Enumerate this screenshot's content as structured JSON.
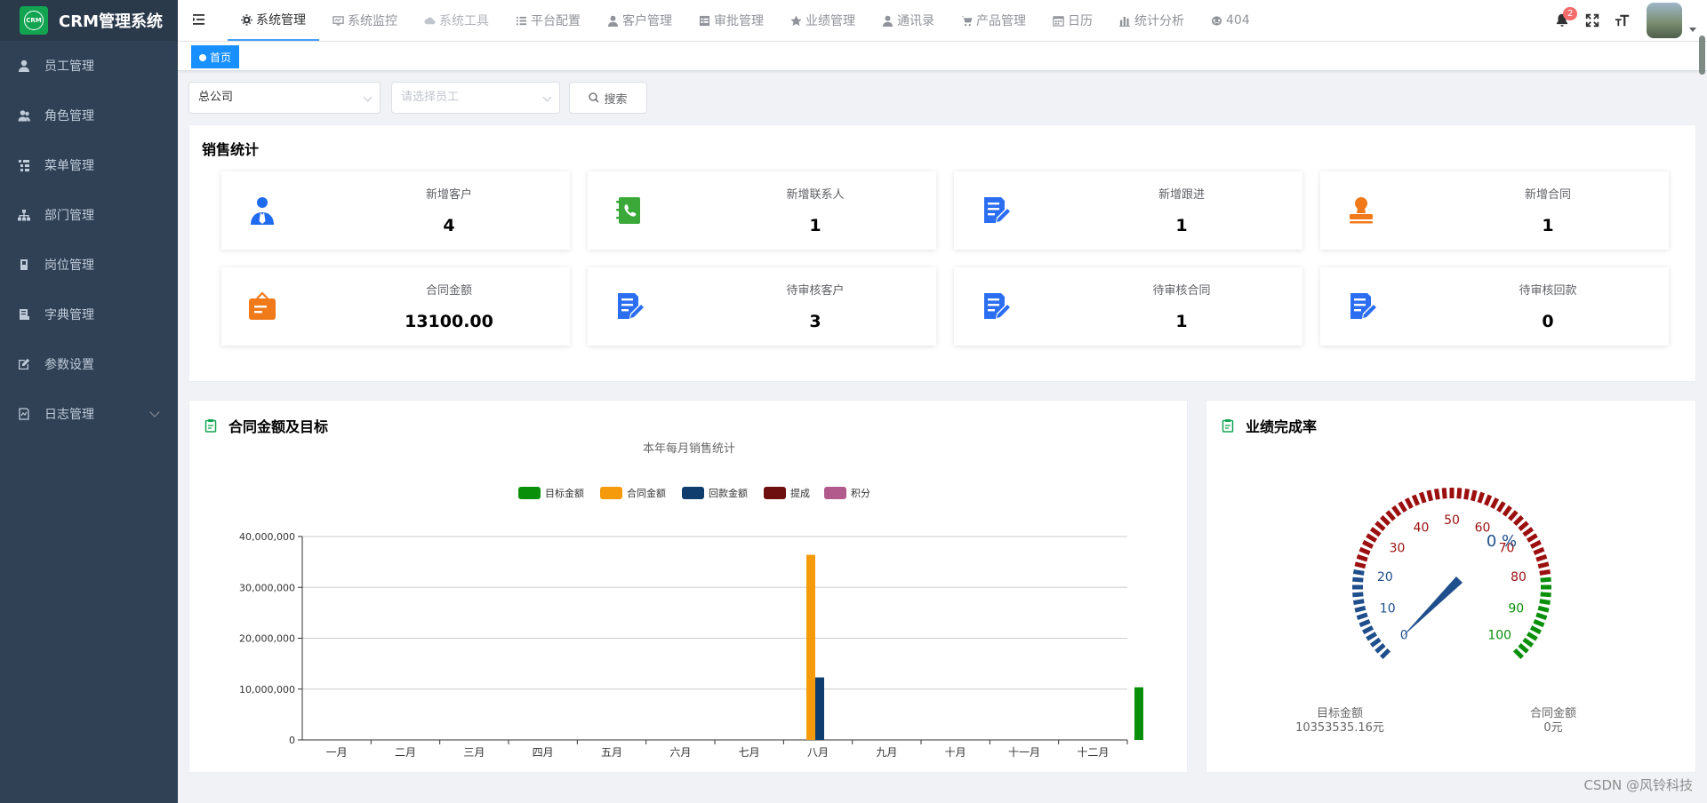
{
  "app": {
    "logo_text": "CRM",
    "title": "CRM管理系统"
  },
  "sidebar": {
    "items": [
      {
        "label": "员工管理",
        "icon": "user-icon"
      },
      {
        "label": "角色管理",
        "icon": "peoples-icon"
      },
      {
        "label": "菜单管理",
        "icon": "tree-table-icon"
      },
      {
        "label": "部门管理",
        "icon": "tree-icon"
      },
      {
        "label": "岗位管理",
        "icon": "post-icon"
      },
      {
        "label": "字典管理",
        "icon": "dict-icon"
      },
      {
        "label": "参数设置",
        "icon": "edit-icon"
      },
      {
        "label": "日志管理",
        "icon": "log-icon"
      }
    ]
  },
  "topnav": {
    "items": [
      {
        "label": "系统管理",
        "state": "active",
        "icon": "gear-icon"
      },
      {
        "label": "系统监控",
        "state": "normal",
        "icon": "monitor-icon"
      },
      {
        "label": "系统工具",
        "state": "disabled",
        "icon": "cloud-icon"
      },
      {
        "label": "平台配置",
        "state": "normal",
        "icon": "list-icon"
      },
      {
        "label": "客户管理",
        "state": "normal",
        "icon": "user-icon"
      },
      {
        "label": "审批管理",
        "state": "normal",
        "icon": "table-icon"
      },
      {
        "label": "业绩管理",
        "state": "normal",
        "icon": "star-icon"
      },
      {
        "label": "通讯录",
        "state": "normal",
        "icon": "user-icon"
      },
      {
        "label": "产品管理",
        "state": "normal",
        "icon": "cart-icon"
      },
      {
        "label": "日历",
        "state": "normal",
        "icon": "calendar-icon"
      },
      {
        "label": "统计分析",
        "state": "normal",
        "icon": "bar-chart-icon"
      },
      {
        "label": "404",
        "state": "normal",
        "icon": "404-icon"
      }
    ],
    "notification_count": "2"
  },
  "tagsview": {
    "active_tag": "首页"
  },
  "filters": {
    "company_value": "总公司",
    "employee_placeholder": "请选择员工",
    "search_label": "搜索"
  },
  "sales": {
    "title": "销售统计",
    "stats": [
      {
        "label": "新增客户",
        "value": "4",
        "icon": "customer-icon",
        "color": "#1e6bf0"
      },
      {
        "label": "新增联系人",
        "value": "1",
        "icon": "contact-book-icon",
        "color": "#3aa93a"
      },
      {
        "label": "新增跟进",
        "value": "1",
        "icon": "document-edit-icon",
        "color": "#2b6ef2"
      },
      {
        "label": "新增合同",
        "value": "1",
        "icon": "stamp-icon",
        "color": "#f07a1a"
      },
      {
        "label": "合同金额",
        "value": "13100.00",
        "icon": "wallet-icon",
        "color": "#f07a1a"
      },
      {
        "label": "待审核客户",
        "value": "3",
        "icon": "document-edit-icon",
        "color": "#2b6ef2"
      },
      {
        "label": "待审核合同",
        "value": "1",
        "icon": "document-edit-icon",
        "color": "#2b6ef2"
      },
      {
        "label": "待审核回款",
        "value": "0",
        "icon": "document-edit-icon",
        "color": "#2b6ef2"
      }
    ]
  },
  "contract_panel": {
    "title": "合同金额及目标"
  },
  "performance_panel": {
    "title": "业绩完成率",
    "target_label": "目标金额",
    "target_value": "10353535.16元",
    "contract_label": "合同金额",
    "contract_value": "0元"
  },
  "chart_data": [
    {
      "type": "bar",
      "title": "本年每月销售统计",
      "categories": [
        "一月",
        "二月",
        "三月",
        "四月",
        "五月",
        "六月",
        "七月",
        "八月",
        "九月",
        "十月",
        "十一月",
        "十二月"
      ],
      "series": [
        {
          "name": "目标金额",
          "color": "#0a8f0a",
          "values": [
            0,
            0,
            0,
            0,
            0,
            0,
            0,
            0,
            0,
            0,
            0,
            0
          ]
        },
        {
          "name": "合同金额",
          "color": "#f59a0b",
          "values": [
            0,
            0,
            0,
            0,
            0,
            0,
            0,
            36400000,
            0,
            0,
            0,
            0
          ]
        },
        {
          "name": "回款金额",
          "color": "#0f3d6e",
          "values": [
            0,
            0,
            0,
            0,
            0,
            0,
            0,
            12300000,
            0,
            0,
            0,
            0
          ]
        },
        {
          "name": "提成",
          "color": "#6d0f0f",
          "values": [
            0,
            0,
            0,
            0,
            0,
            0,
            0,
            0,
            0,
            0,
            0,
            0
          ]
        },
        {
          "name": "积分",
          "color": "#b25a8c",
          "values": [
            0,
            0,
            0,
            0,
            0,
            0,
            0,
            0,
            0,
            0,
            0,
            0
          ]
        }
      ],
      "extra_bar_after_last_category": {
        "series": "目标金额",
        "value": 10353535.16
      },
      "ylim": [
        0,
        40000000
      ],
      "yticks": [
        "0",
        "10,000,000",
        "20,000,000",
        "30,000,000",
        "40,000,000"
      ],
      "grid": true,
      "legend_position": "top-center"
    },
    {
      "type": "gauge",
      "value": 0,
      "value_label": "0 %",
      "min": 0,
      "max": 100,
      "tick_labels": [
        "0",
        "10",
        "20",
        "30",
        "40",
        "50",
        "60",
        "70",
        "80",
        "90",
        "100"
      ],
      "bands": [
        {
          "to": 20,
          "color": "#1f4e8c"
        },
        {
          "to": 80,
          "color": "#9c0f0f"
        },
        {
          "to": 100,
          "color": "#0a8f0a"
        }
      ]
    }
  ],
  "watermark": "CSDN @风铃科技"
}
